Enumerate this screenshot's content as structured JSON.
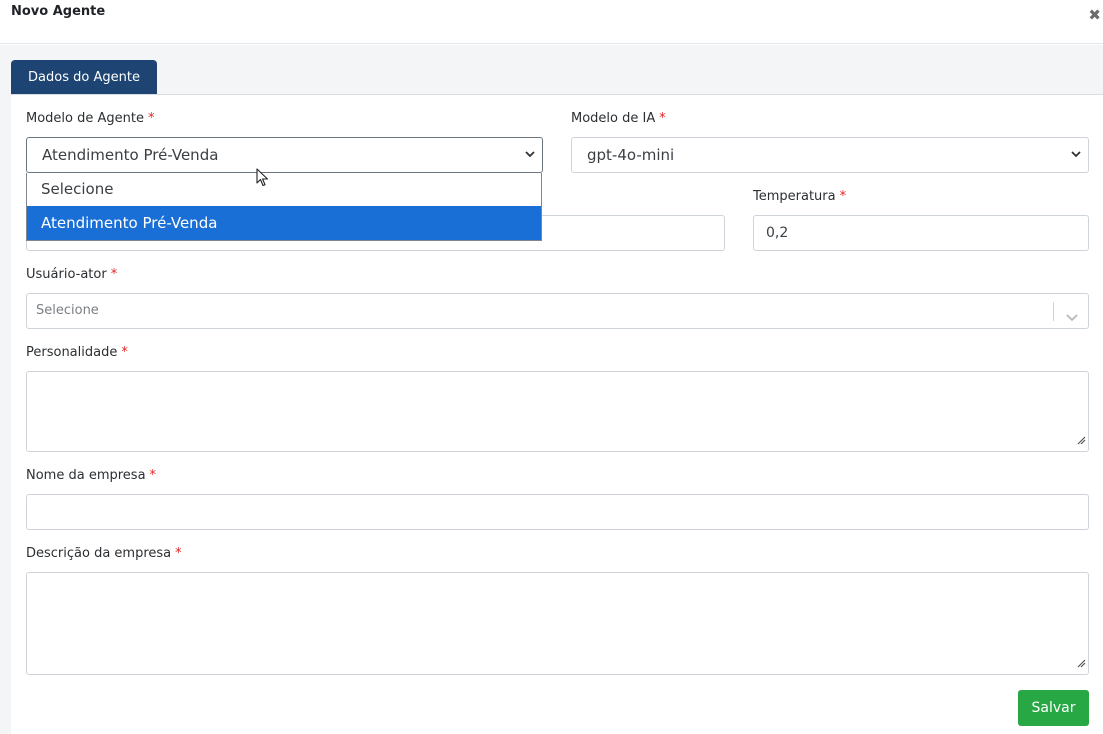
{
  "modal": {
    "title": "Novo Agente",
    "close_icon": "close-icon"
  },
  "tabs": [
    {
      "label": "Dados do Agente",
      "active": true
    }
  ],
  "form": {
    "modelo_agente": {
      "label": "Modelo de Agente",
      "required_mark": "*",
      "value": "Atendimento Pré-Venda",
      "options": [
        "Selecione",
        "Atendimento Pré-Venda"
      ],
      "highlighted_option": "Atendimento Pré-Venda"
    },
    "modelo_ia": {
      "label": "Modelo de IA",
      "required_mark": "*",
      "value": "gpt-4o-mini"
    },
    "temperatura": {
      "label": "Temperatura",
      "required_mark": "*",
      "value": "0,2"
    },
    "usuario_ator": {
      "label": "Usuário-ator",
      "required_mark": "*",
      "placeholder": "Selecione"
    },
    "personalidade": {
      "label": "Personalidade",
      "required_mark": "*",
      "value": ""
    },
    "nome_empresa": {
      "label": "Nome da empresa",
      "required_mark": "*",
      "value": ""
    },
    "descricao_empresa": {
      "label": "Descrição da empresa",
      "required_mark": "*",
      "value": ""
    }
  },
  "actions": {
    "save_label": "Salvar"
  },
  "colors": {
    "tab_active": "#1d4472",
    "option_highlight": "#1a6fd6",
    "save_button": "#28a745",
    "required": "#e02424"
  }
}
